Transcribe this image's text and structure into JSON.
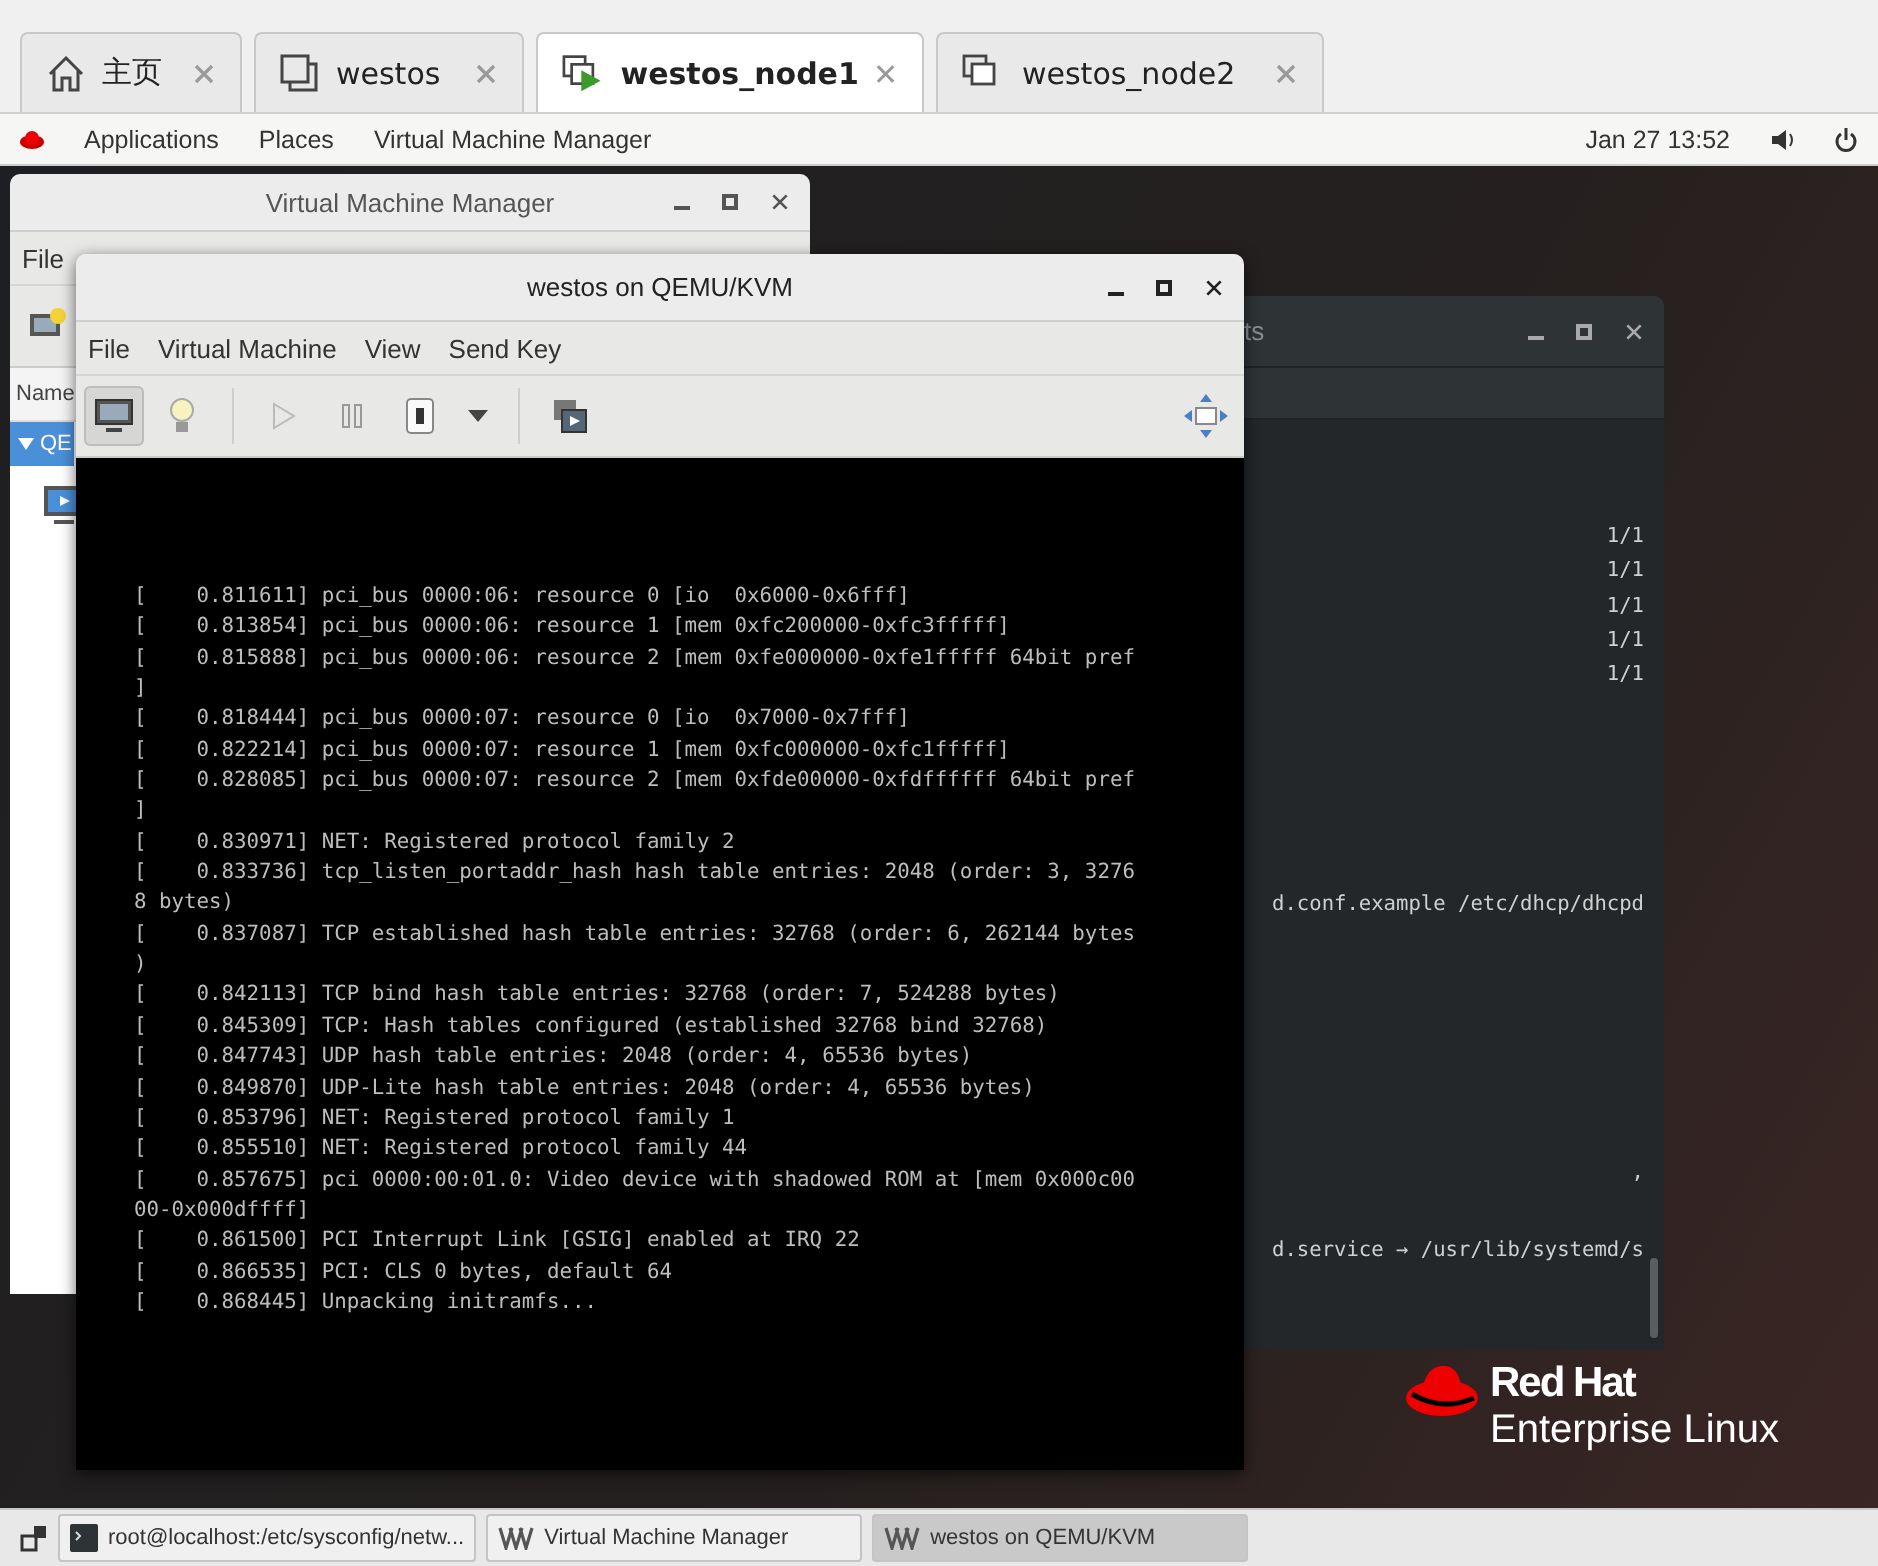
{
  "browser_tabs": [
    {
      "label": "主页",
      "kind": "home",
      "selected": false
    },
    {
      "label": "westos",
      "kind": "window",
      "selected": false
    },
    {
      "label": "westos_node1",
      "kind": "vm_running",
      "selected": true
    },
    {
      "label": "westos_node2",
      "kind": "vm",
      "selected": false
    }
  ],
  "top_bar": {
    "menus": [
      "Applications",
      "Places",
      "Virtual Machine Manager"
    ],
    "clock": "Jan 27 13:52"
  },
  "vmm_window": {
    "title": "Virtual Machine Manager",
    "menu": [
      "File"
    ],
    "column_header": "Name",
    "rows": [
      {
        "label": "QE",
        "selected": true,
        "expanded": true
      }
    ]
  },
  "terminal_window": {
    "title": "ts",
    "counts": [
      "1/1",
      "1/1",
      "1/1",
      "1/1",
      "1/1"
    ],
    "output": [
      "d.conf.example /etc/dhcp/dhcpd",
      ",",
      "d.service → /usr/lib/systemd/s"
    ]
  },
  "qemu_window": {
    "title": "westos on QEMU/KVM",
    "menu": [
      "File",
      "Virtual Machine",
      "View",
      "Send Key"
    ],
    "toolbar": [
      {
        "kind": "console",
        "selected": true
      },
      {
        "kind": "details",
        "selected": false
      },
      {
        "kind": "run"
      },
      {
        "kind": "pause"
      },
      {
        "kind": "shutdown"
      },
      {
        "kind": "dropdown"
      },
      {
        "kind": "snapshots"
      }
    ],
    "console_lines": [
      "[    0.811611] pci_bus 0000:06: resource 0 [io  0x6000-0x6fff]",
      "[    0.813854] pci_bus 0000:06: resource 1 [mem 0xfc200000-0xfc3fffff]",
      "[    0.815888] pci_bus 0000:06: resource 2 [mem 0xfe000000-0xfe1fffff 64bit pref",
      "]",
      "[    0.818444] pci_bus 0000:07: resource 0 [io  0x7000-0x7fff]",
      "[    0.822214] pci_bus 0000:07: resource 1 [mem 0xfc000000-0xfc1fffff]",
      "[    0.828085] pci_bus 0000:07: resource 2 [mem 0xfde00000-0xfdffffff 64bit pref",
      "]",
      "[    0.830971] NET: Registered protocol family 2",
      "[    0.833736] tcp_listen_portaddr_hash hash table entries: 2048 (order: 3, 3276",
      "8 bytes)",
      "[    0.837087] TCP established hash table entries: 32768 (order: 6, 262144 bytes",
      ")",
      "[    0.842113] TCP bind hash table entries: 32768 (order: 7, 524288 bytes)",
      "[    0.845309] TCP: Hash tables configured (established 32768 bind 32768)",
      "[    0.847743] UDP hash table entries: 2048 (order: 4, 65536 bytes)",
      "[    0.849870] UDP-Lite hash table entries: 2048 (order: 4, 65536 bytes)",
      "[    0.853796] NET: Registered protocol family 1",
      "[    0.855510] NET: Registered protocol family 44",
      "[    0.857675] pci 0000:00:01.0: Video device with shadowed ROM at [mem 0x000c00",
      "00-0x000dffff]",
      "[    0.861500] PCI Interrupt Link [GSIG] enabled at IRQ 22",
      "[    0.866535] PCI: CLS 0 bytes, default 64",
      "[    0.868445] Unpacking initramfs..."
    ]
  },
  "logo": {
    "brand": "Red Hat",
    "product": "Enterprise Linux"
  },
  "taskbar": {
    "tasks": [
      {
        "label": "root@localhost:/etc/sysconfig/netw...",
        "kind": "terminal",
        "selected": false
      },
      {
        "label": "Virtual Machine Manager",
        "kind": "vmm",
        "selected": false
      },
      {
        "label": "westos on QEMU/KVM",
        "kind": "vmm",
        "selected": true
      }
    ]
  }
}
